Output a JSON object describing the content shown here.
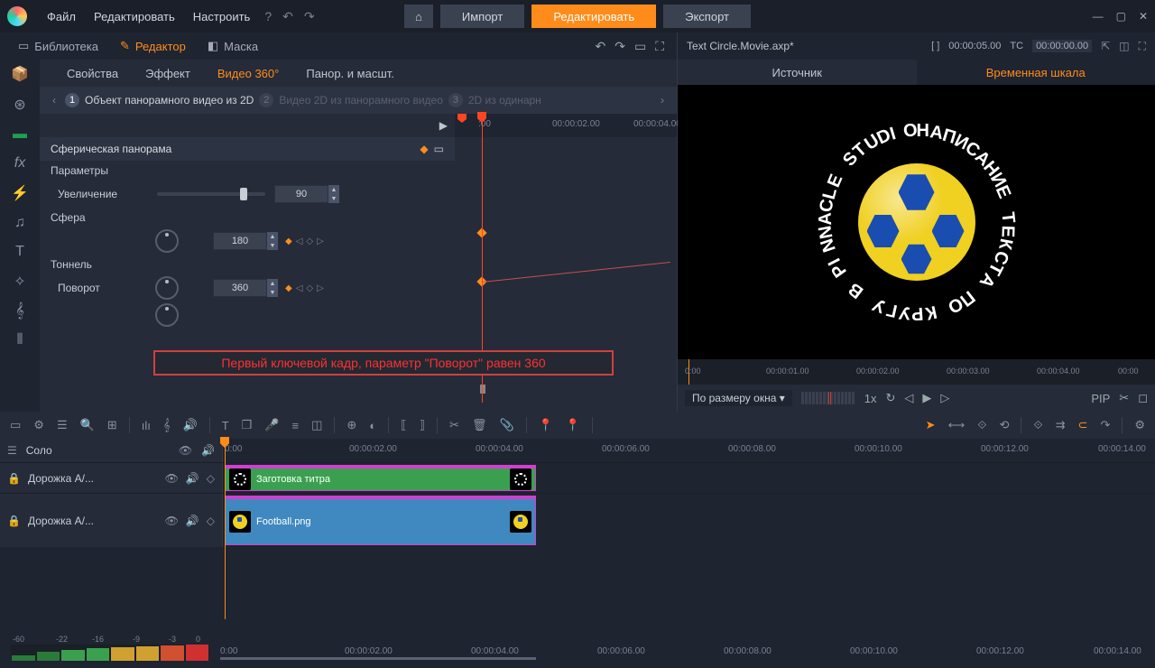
{
  "menu": {
    "file": "Файл",
    "edit": "Редактировать",
    "settings": "Настроить"
  },
  "top_buttons": {
    "import": "Импорт",
    "edit": "Редактировать",
    "export": "Экспорт"
  },
  "panel_tabs": {
    "library": "Библиотека",
    "editor": "Редактор",
    "mask": "Маска"
  },
  "effect_tabs": {
    "properties": "Свойства",
    "effect": "Эффект",
    "video360": "Видео 360°",
    "panzoom": "Панор. и масшт."
  },
  "steps": {
    "s1": "Объект панорамного видео из 2D",
    "s2": "Видео 2D из панорамного видео",
    "s3": "2D из одинарн"
  },
  "section": {
    "spherical": "Сферическая панорама",
    "params": "Параметры"
  },
  "params": {
    "zoom_label": "Увеличение",
    "zoom_value": "90",
    "sphere_label": "Сфера",
    "sphere_value": "180",
    "tunnel_label": "Тоннель",
    "rotate_label": "Поворот",
    "rotate_value": "360"
  },
  "annotation": "Первый ключевой кадр, параметр \"Поворот\" равен 360",
  "kf_ruler": {
    "t0": ":00",
    "t1": "00:00:02.00",
    "t2": "00:00:04.00"
  },
  "preview": {
    "filename": "Text Circle.Movie.axp*",
    "bracket": "[ ]",
    "tc1": "00:00:05.00",
    "tc_label": "TC",
    "tc2": "00:00:00.00",
    "tab_source": "Источник",
    "tab_timeline": "Временная шкала",
    "circle_text": "НАПИСАНИЕ ТЕКСТА ПО КРУГУ В PINNACLE STUDIO",
    "fit": "По размеру окна",
    "speed": "1x",
    "pip": "PIP",
    "r0": "0:00",
    "r1": "00:00:01.00",
    "r2": "00:00:02.00",
    "r3": "00:00:03.00",
    "r4": "00:00:04.00",
    "r5": "00:00"
  },
  "tl": {
    "solo": "Соло",
    "track1": "Дорожка A/...",
    "track2": "Дорожка A/...",
    "clip1": "Заготовка титра",
    "clip2": "Football.png",
    "rt0": "0:00",
    "rt1": "00:00:02.00",
    "rt2": "00:00:04.00",
    "rt3": "00:00:06.00",
    "rt4": "00:00:08.00",
    "rt5": "00:00:10.00",
    "rt6": "00:00:12.00",
    "rt7": "00:00:14.00",
    "vu": {
      "m60": "-60",
      "m22": "-22",
      "m16": "-16",
      "m9": "-9",
      "m3": "-3",
      "z": "0"
    }
  }
}
